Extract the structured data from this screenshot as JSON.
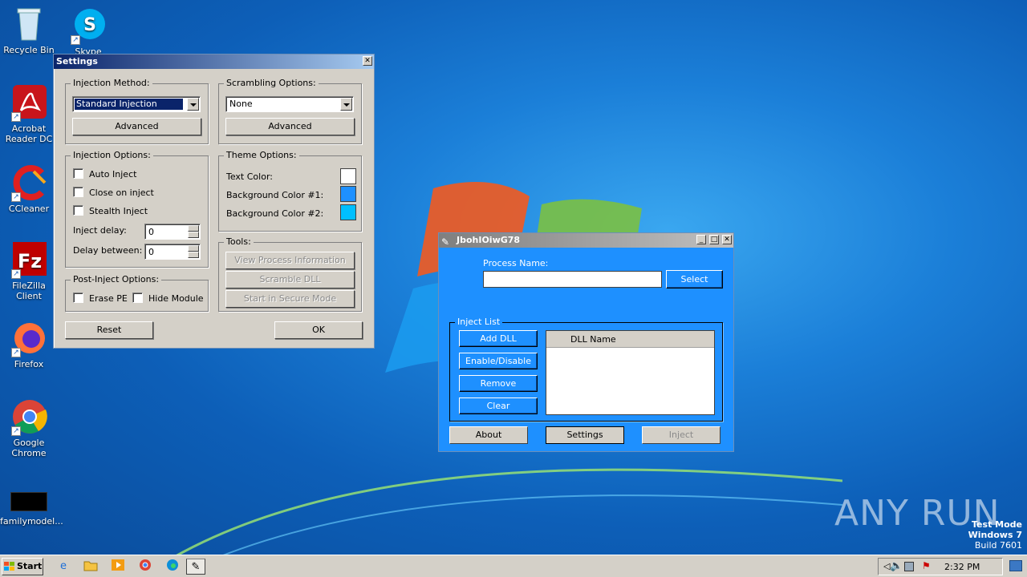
{
  "desktop": {
    "icons": [
      {
        "label": "Recycle Bin",
        "icon": "recycle-bin-icon"
      },
      {
        "label": "Skype",
        "icon": "skype-icon"
      },
      {
        "label": "Acrobat Reader DC",
        "icon": "acrobat-icon"
      },
      {
        "label": "CCleaner",
        "icon": "ccleaner-icon"
      },
      {
        "label": "FileZilla Client",
        "icon": "filezilla-icon"
      },
      {
        "label": "Firefox",
        "icon": "firefox-icon"
      },
      {
        "label": "Google Chrome",
        "icon": "chrome-icon"
      },
      {
        "label": "familymodel...",
        "icon": "file-icon"
      }
    ],
    "watermark": "ANY RUN",
    "test_mode": {
      "line1": "Test Mode",
      "line2": "Windows 7",
      "line3": "Build 7601"
    }
  },
  "settings": {
    "title": "Settings",
    "close": "✕",
    "injection_method": {
      "legend": "Injection Method:",
      "selected": "Standard Injection",
      "advanced": "Advanced"
    },
    "scrambling": {
      "legend": "Scrambling Options:",
      "selected": "None",
      "advanced": "Advanced"
    },
    "injection_options": {
      "legend": "Injection Options:",
      "auto_inject": "Auto Inject",
      "close_on_inject": "Close on inject",
      "stealth_inject": "Stealth Inject",
      "inject_delay_label": "Inject delay:",
      "inject_delay_value": "0",
      "delay_between_label": "Delay between:",
      "delay_between_value": "0"
    },
    "theme": {
      "legend": "Theme Options:",
      "text_color": "Text Color:",
      "bg1": "Background Color #1:",
      "bg2": "Background Color #2:",
      "colors": {
        "text": "#ffffff",
        "bg1": "#1e90ff",
        "bg2": "#00bfff"
      }
    },
    "tools": {
      "legend": "Tools:",
      "view_process": "View Process Information",
      "scramble_dll": "Scramble DLL",
      "secure_mode": "Start in Secure Mode"
    },
    "post_inject": {
      "legend": "Post-Inject Options:",
      "erase_pe": "Erase PE",
      "hide_module": "Hide Module"
    },
    "reset": "Reset",
    "ok": "OK"
  },
  "injector": {
    "title": "JbohIOiwG78",
    "process_label": "Process Name:",
    "process_value": "",
    "select": "Select",
    "inject_list_legend": "Inject List",
    "add_dll": "Add DLL",
    "enable_disable": "Enable/Disable",
    "remove": "Remove",
    "clear": "Clear",
    "dll_column": "DLL Name",
    "about": "About",
    "settings": "Settings",
    "inject": "Inject"
  },
  "taskbar": {
    "start": "Start",
    "clock": "2:32 PM",
    "pinned": [
      "ie-icon",
      "explorer-icon",
      "media-player-icon",
      "chrome-icon",
      "edge-icon",
      "injector-icon"
    ]
  }
}
